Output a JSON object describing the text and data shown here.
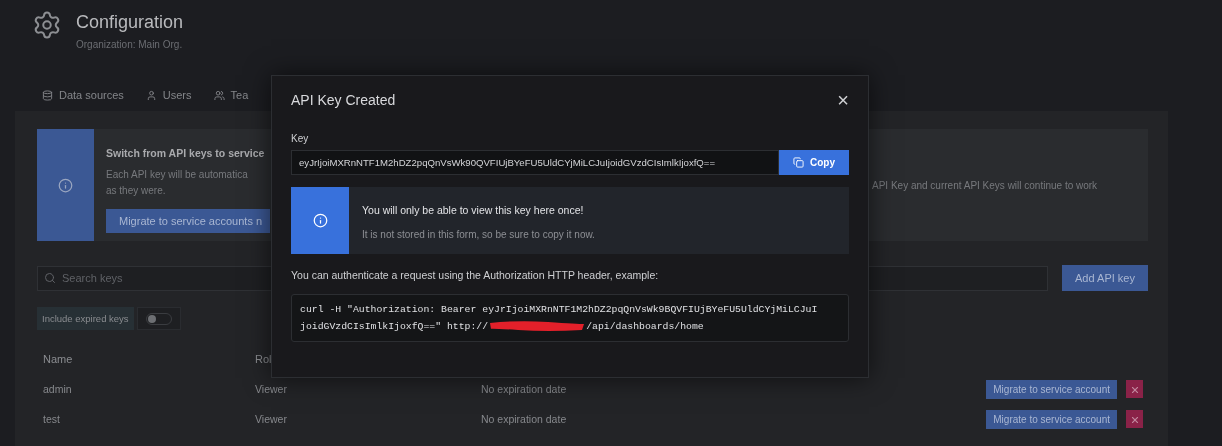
{
  "header": {
    "title": "Configuration",
    "subtitle": "Organization: Main Org."
  },
  "tabs": [
    {
      "label": "Data sources",
      "selected": false
    },
    {
      "label": "Users",
      "selected": false
    },
    {
      "label": "Tea",
      "selected": false
    }
  ],
  "banner": {
    "title": "Switch from API keys to service",
    "text_left": "Each API key will be automatica",
    "text_left_2": "as they were.",
    "text_right": "API Key and current API Keys will continue to work",
    "button": "Migrate to service accounts n"
  },
  "search": {
    "placeholder": "Search keys"
  },
  "add_button": "Add API key",
  "expired_toggle": {
    "label": "Include expired keys",
    "on": false
  },
  "table": {
    "columns": [
      "Name",
      "Rol"
    ],
    "rows": [
      {
        "name": "admin",
        "role": "Viewer",
        "expires": "No expiration date",
        "action": "Migrate to service account"
      },
      {
        "name": "test",
        "role": "Viewer",
        "expires": "No expiration date",
        "action": "Migrate to service account"
      }
    ]
  },
  "modal": {
    "title": "API Key Created",
    "close": "×",
    "key_label": "Key",
    "key_value": "eyJrIjoiMXRnNTF1M2hDZ2pqQnVsWk90QVFIUjBYeFU5UldCYjMiLCJuIjoidGVzdCIsImlkIjoxfQ==",
    "copy_button": "Copy",
    "alert": {
      "title": "You will only be able to view this key here once!",
      "text": "It is not stored in this form, so be sure to copy it now."
    },
    "hint": "You can authenticate a request using the Authorization HTTP header, example:",
    "code": {
      "line_1": "curl -H \"Authorization: Bearer eyJrIjoiMXRnNTF1M2hDZ2pqQnVsWk9BQVFIUjBYeFU5UldCYjMiLCJuI",
      "line_2_start": "joidGVzdCIsImlkIjoxfQ==\" http://",
      "line_2_end": "/api/dashboards/home"
    }
  }
}
